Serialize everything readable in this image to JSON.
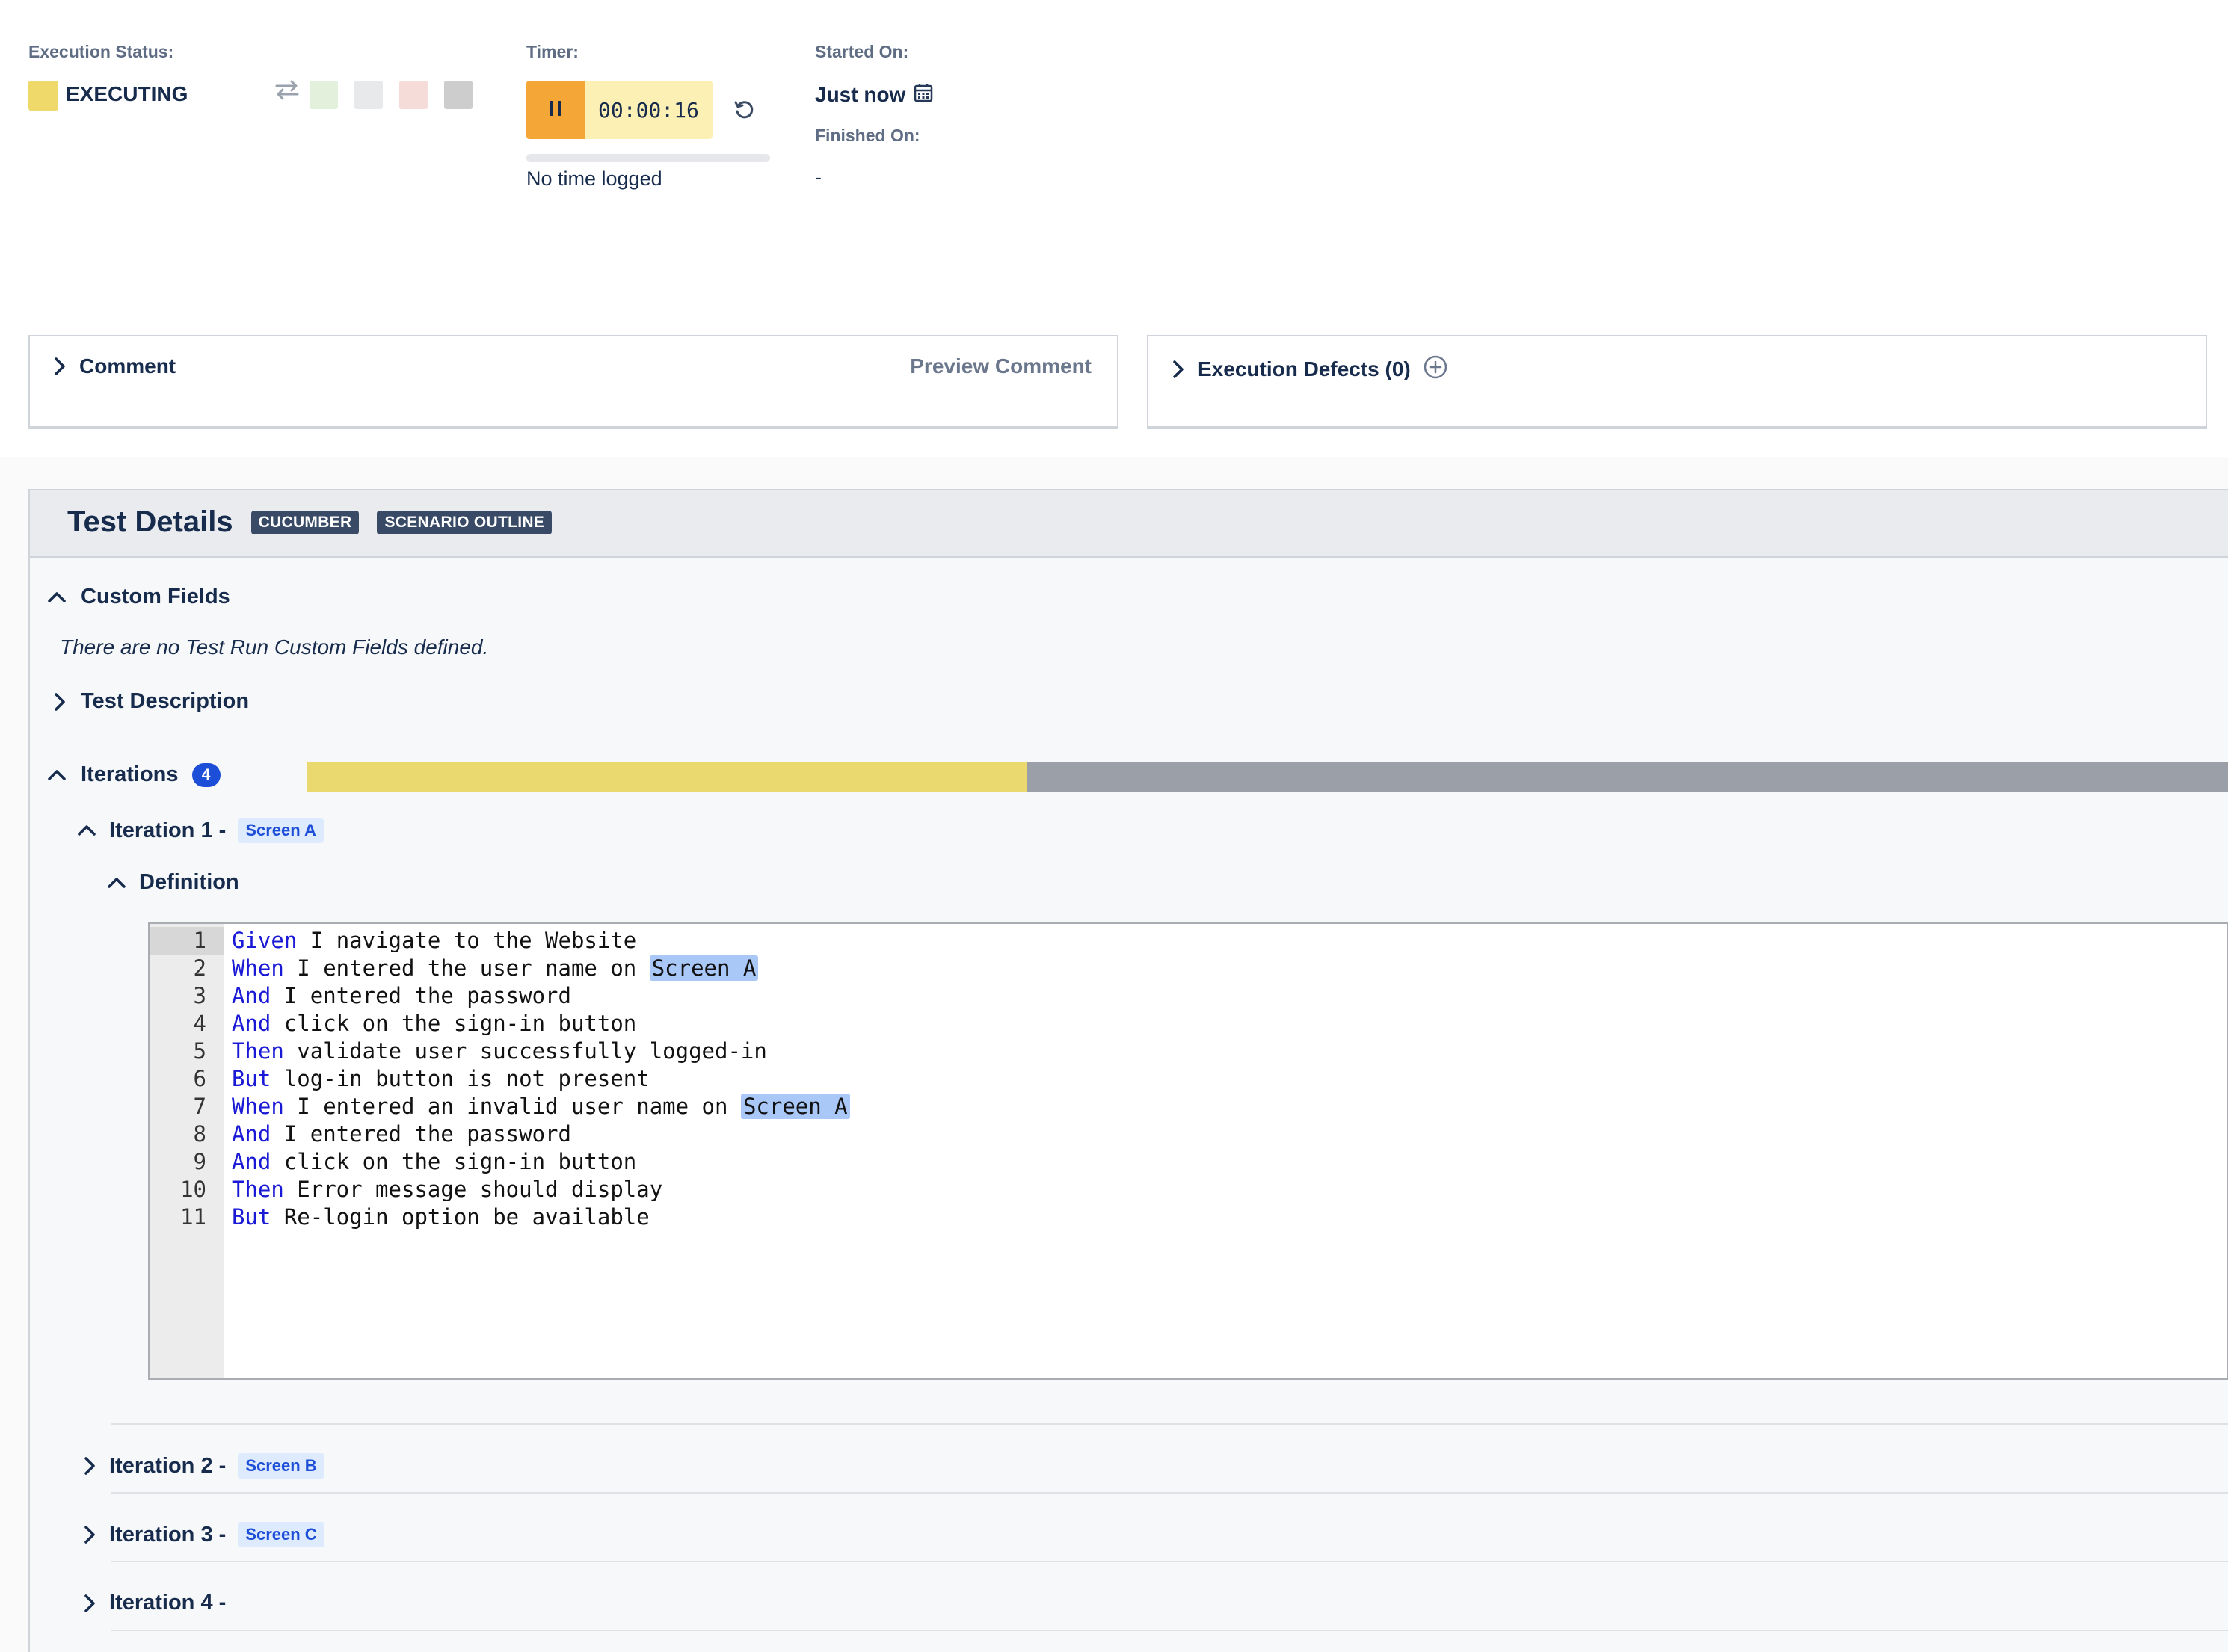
{
  "execution": {
    "status_label": "Execution Status:",
    "status_value": "EXECUTING",
    "status_color": "#efd96a",
    "status_options": [
      {
        "name": "pass",
        "color": "#e3f0dc"
      },
      {
        "name": "not-executed",
        "color": "#e8e9eb"
      },
      {
        "name": "fail",
        "color": "#f5dcd8"
      },
      {
        "name": "blocked",
        "color": "#cdcdcd"
      }
    ]
  },
  "timer": {
    "label": "Timer:",
    "value": "00:00:16",
    "logged": "No time logged",
    "progress": 0
  },
  "dates": {
    "started_label": "Started On:",
    "started_value": "Just now",
    "finished_label": "Finished On:",
    "finished_value": "-"
  },
  "comment_panel": {
    "title": "Comment",
    "preview_label": "Preview Comment"
  },
  "defects_panel": {
    "title": "Execution Defects (0)"
  },
  "test_details": {
    "title": "Test Details",
    "tags": [
      "CUCUMBER",
      "SCENARIO OUTLINE"
    ],
    "custom_fields": {
      "title": "Custom Fields",
      "note": "There are no Test Run Custom Fields defined."
    },
    "description": {
      "title": "Test Description"
    },
    "iterations": {
      "title": "Iterations",
      "count": "4",
      "progress_executing": 0.375,
      "progress_colors": {
        "executing": "#e9d96f",
        "todo": "#9a9fa8"
      },
      "items": [
        {
          "label": "Iteration 1 -",
          "tag": "Screen A"
        },
        {
          "label": "Iteration 2 -",
          "tag": "Screen B"
        },
        {
          "label": "Iteration 3 -",
          "tag": "Screen C"
        },
        {
          "label": "Iteration 4 -",
          "tag": ""
        }
      ],
      "definition_title": "Definition"
    }
  },
  "editor": {
    "lines": [
      {
        "n": "1",
        "kw": "Given",
        "rest": " I navigate to the Website",
        "hl": "",
        "tail": ""
      },
      {
        "n": "2",
        "kw": "When",
        "rest": " I entered the user name on ",
        "hl": "Screen A",
        "tail": ""
      },
      {
        "n": "3",
        "kw": "And",
        "rest": " I entered the password",
        "hl": "",
        "tail": ""
      },
      {
        "n": "4",
        "kw": "And",
        "rest": " click on the sign-in button",
        "hl": "",
        "tail": ""
      },
      {
        "n": "5",
        "kw": "Then",
        "rest": " validate user successfully logged-in",
        "hl": "",
        "tail": ""
      },
      {
        "n": "6",
        "kw": "But",
        "rest": " log-in button is not present",
        "hl": "",
        "tail": ""
      },
      {
        "n": "7",
        "kw": "When",
        "rest": " I entered an invalid user name on ",
        "hl": "Screen A",
        "tail": ""
      },
      {
        "n": "8",
        "kw": "And",
        "rest": " I entered the password",
        "hl": "",
        "tail": ""
      },
      {
        "n": "9",
        "kw": "And",
        "rest": " click on the sign-in button",
        "hl": "",
        "tail": ""
      },
      {
        "n": "10",
        "kw": "Then",
        "rest": " Error message should display",
        "hl": "",
        "tail": ""
      },
      {
        "n": "11",
        "kw": "But",
        "rest": " Re-login option be available",
        "hl": "",
        "tail": ""
      }
    ]
  },
  "icons": {
    "transition": "swap-arrows-icon",
    "pause": "pause-icon",
    "reset": "reset-icon",
    "calendar": "calendar-icon",
    "add": "add-circle-icon",
    "chevron_right": "chevron-right-icon",
    "chevron_up": "chevron-up-icon"
  }
}
